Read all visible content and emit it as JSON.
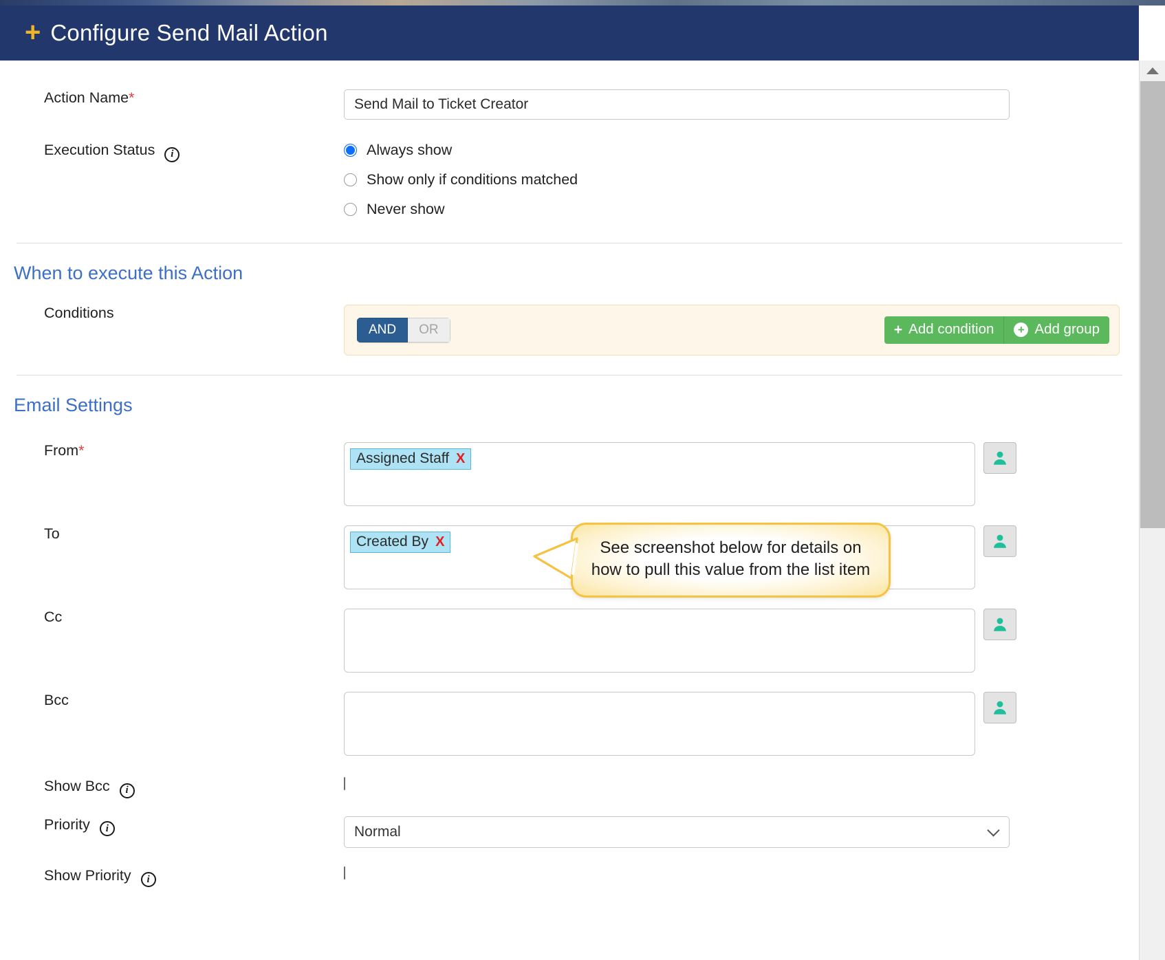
{
  "window": {
    "title": "Configure Send Mail Action",
    "title_icon": "plus-icon",
    "header_bg": "#22376b",
    "accent_gold": "#f0b429"
  },
  "form": {
    "action_name": {
      "label": "Action Name",
      "required_mark": "*",
      "value": "Send Mail to Ticket Creator",
      "placeholder": ""
    },
    "execution_status": {
      "label": "Execution Status",
      "info_icon": "info-icon",
      "options": [
        {
          "label": "Always show",
          "selected": true
        },
        {
          "label": "Show only if conditions matched",
          "selected": false
        },
        {
          "label": "Never show",
          "selected": false
        }
      ]
    }
  },
  "when_section": {
    "heading": "When to execute this Action",
    "conditions": {
      "label": "Conditions",
      "logic_toggle": {
        "and": "AND",
        "or": "OR",
        "active": "AND"
      },
      "add_condition": {
        "label": "Add condition",
        "icon": "plus-icon"
      },
      "add_group": {
        "label": "Add group",
        "icon": "plus-circle-icon"
      },
      "panel_bg": "#fdf6e9",
      "button_color": "#5cb85c"
    }
  },
  "email_section": {
    "heading": "Email Settings",
    "fields": {
      "from": {
        "label": "From",
        "required_mark": "*",
        "chips": [
          {
            "text": "Assigned Staff",
            "remove": "X"
          }
        ],
        "picker_icon": "person-icon"
      },
      "to": {
        "label": "To",
        "required_mark": "",
        "chips": [
          {
            "text": "Created By",
            "remove": "X"
          }
        ],
        "picker_icon": "person-icon"
      },
      "cc": {
        "label": "Cc",
        "required_mark": "",
        "chips": [],
        "picker_icon": "person-icon"
      },
      "bcc": {
        "label": "Bcc",
        "required_mark": "",
        "chips": [],
        "picker_icon": "person-icon"
      },
      "show_bcc": {
        "label": "Show Bcc",
        "info_icon": "info-icon",
        "checked": false
      },
      "priority": {
        "label": "Priority",
        "info_icon": "info-icon",
        "value": "Normal"
      },
      "show_priority": {
        "label": "Show Priority",
        "info_icon": "info-icon",
        "checked": false
      }
    }
  },
  "callout": {
    "text": "See screenshot below for details on how to pull this value from the list item",
    "border_color": "#f5c242"
  },
  "scrollbar": {
    "up_arrow": "caret-up-icon"
  }
}
